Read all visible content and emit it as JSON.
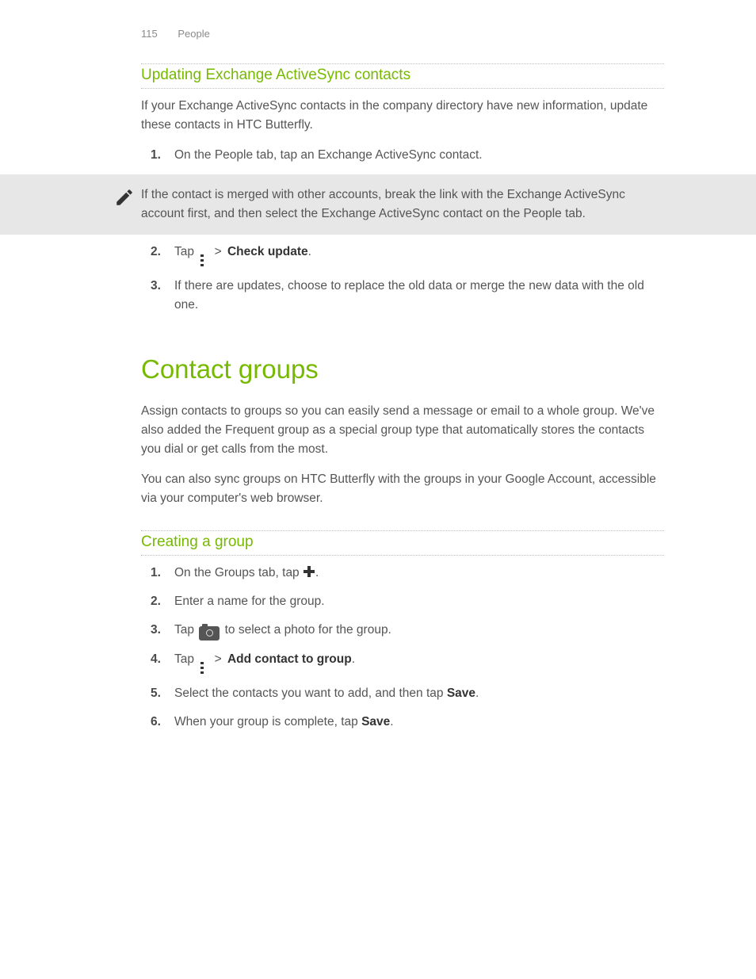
{
  "header": {
    "page_number": "115",
    "section": "People"
  },
  "sec1": {
    "subhead": "Updating Exchange ActiveSync contacts",
    "intro": "If your Exchange ActiveSync contacts in the company directory have new information, update these contacts in HTC Butterfly.",
    "step1": "On the People tab, tap an Exchange ActiveSync contact.",
    "note": "If the contact is merged with other accounts, break the link with the Exchange ActiveSync account first, and then select the Exchange ActiveSync contact on the People tab.",
    "step2_a": "Tap ",
    "step2_gt": " > ",
    "step2_b": "Check update",
    "step2_c": ".",
    "step3": "If there are updates, choose to replace the old data or merge the new data with the old one."
  },
  "sec2": {
    "heading": "Contact groups",
    "p1": "Assign contacts to groups so you can easily send a message or email to a whole group. We've also added the Frequent group as a special group type that automatically stores the contacts you dial or get calls from the most.",
    "p2": "You can also sync groups on HTC Butterfly with the groups in your Google Account, accessible via your computer's web browser."
  },
  "sec3": {
    "subhead": "Creating a group",
    "step1_a": "On the Groups tab, tap ",
    "step1_b": ".",
    "step2": "Enter a name for the group.",
    "step3_a": "Tap ",
    "step3_b": " to select a photo for the group.",
    "step4_a": "Tap ",
    "step4_gt": " > ",
    "step4_b": "Add contact to group",
    "step4_c": ".",
    "step5_a": "Select the contacts you want to add, and then tap ",
    "step5_b": "Save",
    "step5_c": ".",
    "step6_a": "When your group is complete, tap ",
    "step6_b": "Save",
    "step6_c": "."
  }
}
